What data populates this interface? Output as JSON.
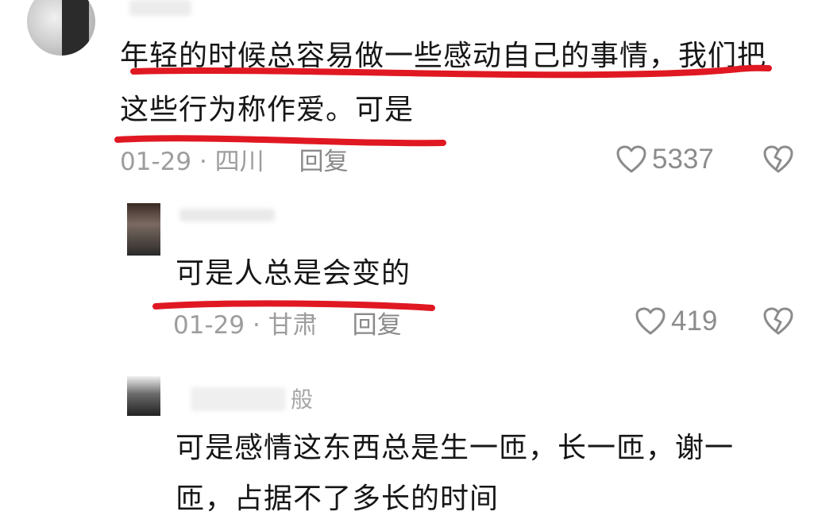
{
  "comments": [
    {
      "text_lines": [
        "年轻的时候总容易做一些感动自己的事情，我们把",
        "这些行为称作爱。可是"
      ],
      "date": "01-29",
      "separator": " · ",
      "location": "四川",
      "reply_label": "回复",
      "like_count": "5337"
    }
  ],
  "replies": [
    {
      "text_lines": [
        "可是人总是会变的"
      ],
      "date": "01-29",
      "separator": " · ",
      "location": "甘肃",
      "reply_label": "回复",
      "like_count": "419"
    },
    {
      "author_visible_suffix": "般",
      "text_lines": [
        "可是感情这东西总是生一匝，长一匝，谢一",
        "匝，占据不了多长的时间"
      ]
    }
  ],
  "icons": {
    "like": "heart-outline-icon",
    "dislike": "broken-heart-icon"
  },
  "colors": {
    "annotation_underline": "#e01822",
    "meta_text": "#9d9d9d",
    "body_text": "#161616",
    "icon_stroke": "#8c8c8c"
  }
}
